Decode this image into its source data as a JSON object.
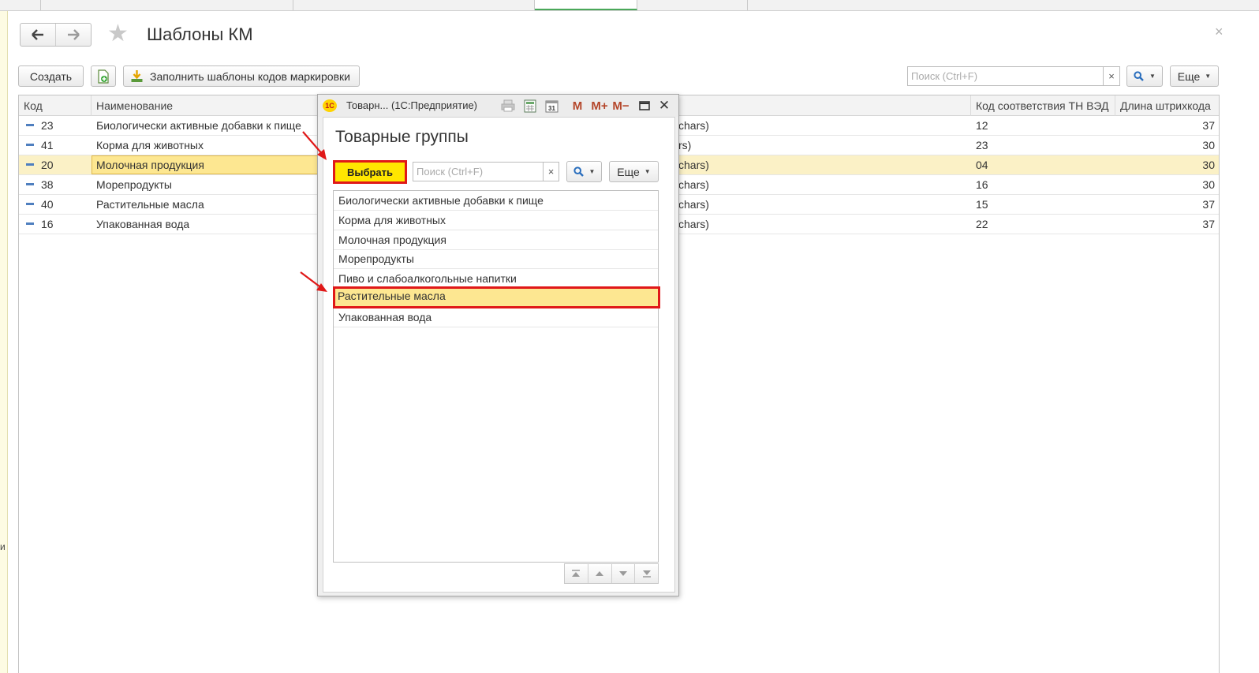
{
  "header": {
    "title": "Шаблоны КМ",
    "close_glyph": "×"
  },
  "toolbar": {
    "create_label": "Создать",
    "fill_label": "Заполнить шаблоны кодов маркировки",
    "search_placeholder": "Поиск (Ctrl+F)",
    "clear_glyph": "×",
    "more_label": "Еще"
  },
  "table": {
    "columns": [
      "Код",
      "Наименование",
      "Код соответствия ТН ВЭД",
      "Длина штрихкода"
    ],
    "rows": [
      {
        "code": "23",
        "name": "Биологически активные добавки к пище",
        "hidden_tail": "chars)",
        "tnved": "12",
        "length": "37"
      },
      {
        "code": "41",
        "name": "Корма для животных",
        "hidden_tail": "rs)",
        "tnved": "23",
        "length": "30"
      },
      {
        "code": "20",
        "name": "Молочная продукция",
        "hidden_tail": "chars)",
        "tnved": "04",
        "length": "30"
      },
      {
        "code": "38",
        "name": "Морепродукты",
        "hidden_tail": "chars)",
        "tnved": "16",
        "length": "30"
      },
      {
        "code": "40",
        "name": "Растительные масла",
        "hidden_tail": "chars)",
        "tnved": "15",
        "length": "37"
      },
      {
        "code": "16",
        "name": "Упакованная вода",
        "hidden_tail": "chars)",
        "tnved": "22",
        "length": "37"
      }
    ]
  },
  "modal": {
    "window_title": "Товарн... (1С:Предприятие)",
    "logo_text": "1С",
    "toolbar_m": "M",
    "toolbar_mplus": "M+",
    "toolbar_mminus": "M−",
    "close_glyph": "✕",
    "heading": "Товарные группы",
    "choose_label": "Выбрать",
    "search_placeholder": "Поиск (Ctrl+F)",
    "clear_glyph": "×",
    "more_label": "Еще",
    "items": [
      "Биологически активные добавки к пище",
      "Корма для животных",
      "Молочная продукция",
      "Морепродукты",
      "Пиво и слабоалкогольные напитки",
      "Растительные масла",
      "Упакованная вода"
    ],
    "selected_item": "Растительные масла"
  },
  "left_marker": "и",
  "colors": {
    "selection": "#fde791",
    "highlight_border": "#e01818",
    "choose_button": "#ffe600"
  }
}
